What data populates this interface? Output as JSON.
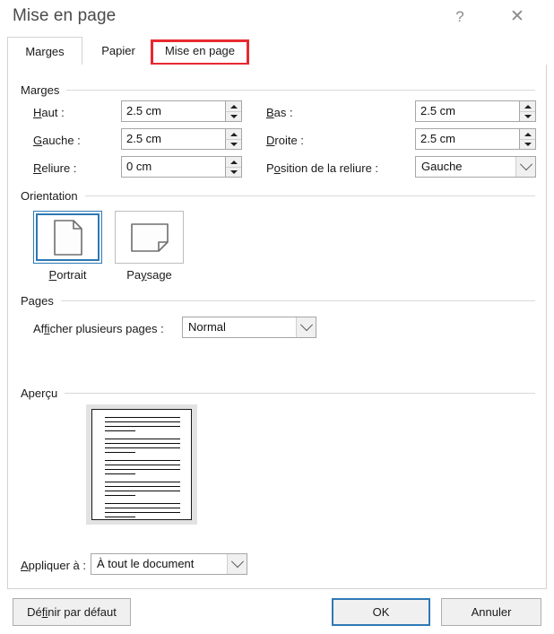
{
  "window": {
    "title": "Mise en page",
    "help_label": "?",
    "close_label": "✕",
    "help_icon": "question-mark-icon",
    "close_icon": "close-icon"
  },
  "tabs": [
    {
      "id": "marges",
      "label": "Marges",
      "selected": true
    },
    {
      "id": "papier",
      "label": "Papier",
      "selected": false
    },
    {
      "id": "mise-en-page",
      "label": "Mise en page",
      "selected": false
    }
  ],
  "highlight": {
    "target": "Mise en page",
    "color": "#e8292f"
  },
  "groups": {
    "marges": "Marges",
    "orientation": "Orientation",
    "pages": "Pages",
    "apercu": "Aperçu"
  },
  "margins": {
    "top": {
      "label": "Haut :",
      "accel": "H",
      "value": "2.5 cm"
    },
    "bottom": {
      "label": "Bas :",
      "accel": "B",
      "value": "2.5 cm"
    },
    "left": {
      "label": "Gauche :",
      "accel": "G",
      "value": "2.5 cm"
    },
    "right": {
      "label": "Droite :",
      "accel": "D",
      "value": "2.5 cm"
    },
    "gutter": {
      "label": "Reliure :",
      "accel": "R",
      "value": "0 cm"
    },
    "gutter_pos": {
      "label": "Position de la reliure :",
      "accel": "o",
      "value": "Gauche"
    }
  },
  "orientation": {
    "portrait": {
      "label": "Portrait",
      "accel": "P",
      "selected": true,
      "icon": "page-portrait-icon"
    },
    "paysage": {
      "label": "Paysage",
      "accel": "y",
      "selected": false,
      "icon": "page-landscape-icon"
    }
  },
  "pages": {
    "multiple_label": "Afficher plusieurs pages :",
    "multiple_accel": "fi",
    "multiple_value": "Normal"
  },
  "apply": {
    "label": "Appliquer à :",
    "accel": "A",
    "value": "À tout le document"
  },
  "footer": {
    "set_default": "Définir par défaut",
    "ok": "OK",
    "cancel": "Annuler"
  },
  "colors": {
    "accent": "#2e78b5",
    "highlight": "#e8292f",
    "dialog_bg": "#ffffff",
    "control_border": "#a6a6a6",
    "button_face": "#f0f0f0"
  }
}
